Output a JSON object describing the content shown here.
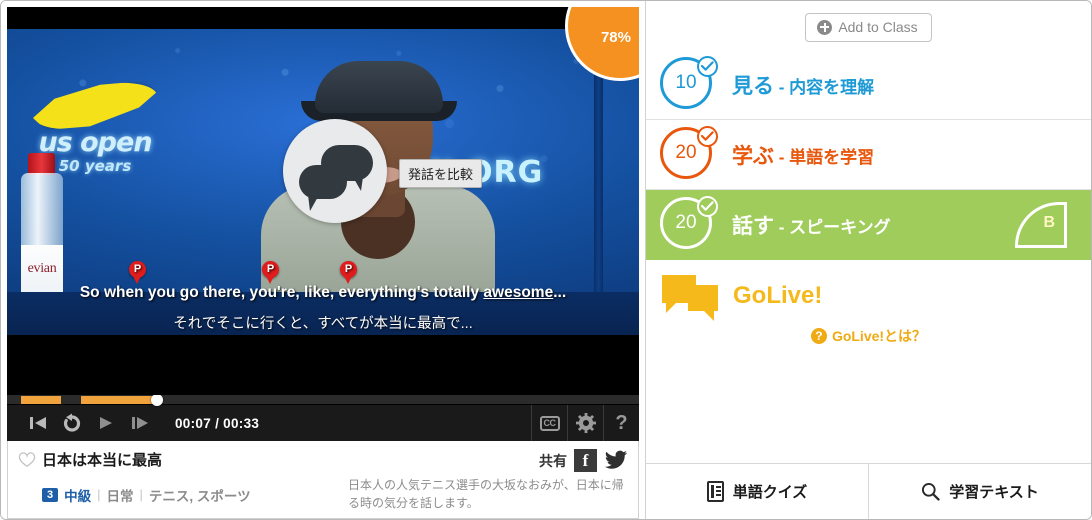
{
  "video": {
    "score_badge": "78%",
    "overlay_icon": "speech-bubbles-icon",
    "tooltip": "発話を比較",
    "backdrop_logo_word": "us open",
    "backdrop_logo_sub": "50 years",
    "backdrop_url_text": "EN.ORG",
    "bottle_brand": "evian",
    "subtitle_en_pre": "So when you go there, you're, like, everything's totally ",
    "subtitle_en_highlight": "awesome",
    "subtitle_en_post": "...",
    "subtitle_ja": "それでそこに行くと、すべてが本当に最高で...",
    "pin_label": "P",
    "controls": {
      "step_back": "step-back",
      "replay": "replay",
      "play": "play",
      "step_forward": "step-forward",
      "time": "00:07 / 00:33",
      "cc": "CC",
      "settings": "settings",
      "help": "?"
    }
  },
  "meta": {
    "favorite_icon": "heart-outline-icon",
    "title": "日本は本当に最高",
    "share_label": "共有",
    "facebook": "f",
    "level_number": "3",
    "level_label": "中級",
    "tag_category": "日常",
    "tag_topics": "テニス, スポーツ",
    "description": "日本人の人気テニス選手の大坂なおみが、日本に帰る時の気分を話します。"
  },
  "sidebar": {
    "add_to_class": "Add to Class",
    "lessons": [
      {
        "points": "10",
        "title": "見る",
        "dash": " - ",
        "subtitle": "内容を理解",
        "color": "#1e9ad6",
        "completed": true,
        "active": false
      },
      {
        "points": "20",
        "title": "学ぶ",
        "dash": " - ",
        "subtitle": "単語を学習",
        "color": "#e8570c",
        "completed": true,
        "active": false
      },
      {
        "points": "20",
        "title": "話す",
        "dash": " - ",
        "subtitle": "スピーキング",
        "color": "#ffffff",
        "completed": true,
        "active": true,
        "grade": "B"
      }
    ],
    "golive": {
      "title": "GoLive!",
      "help_link": "GoLive!とは？"
    },
    "bottom_buttons": [
      {
        "icon": "notepad-icon",
        "label": "単語クイズ"
      },
      {
        "icon": "magnifier-icon",
        "label": "学習テキスト"
      }
    ]
  },
  "colors": {
    "blue": "#1e9ad6",
    "orange": "#e8570c",
    "green": "#9fcc5b",
    "yellow": "#f5b91c",
    "progress": "#f0a33c",
    "badge_orange": "#f59120",
    "level_blue": "#1f5fa8"
  }
}
